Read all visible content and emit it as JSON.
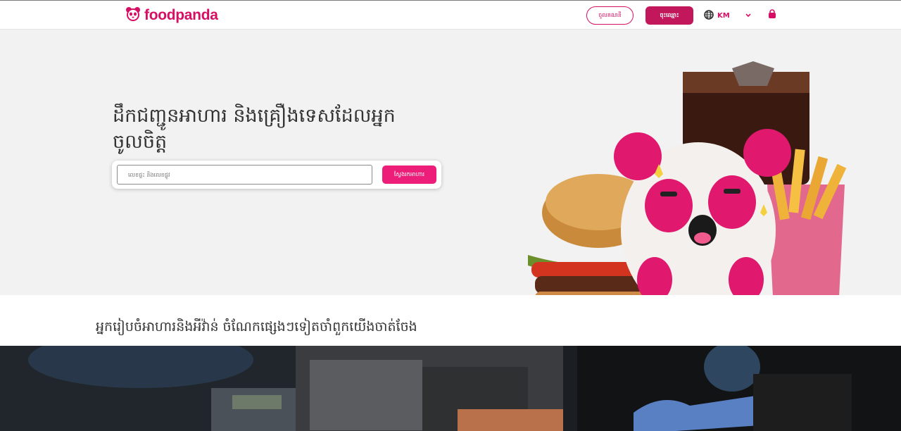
{
  "header": {
    "brand": "foodpanda",
    "login_label": "ចូលគណនី",
    "signup_label": "ចុះឈ្មោះ",
    "language": "KM",
    "icons": [
      "panda-logo-icon",
      "globe-icon",
      "chevron-down-icon",
      "shopping-bag-icon"
    ]
  },
  "hero": {
    "title": "ដឹកជញ្ជូនអាហារ និងគ្រឿងទេសដែលអ្នកចូលចិត្ត",
    "search": {
      "placeholder": "លេខផ្ទះ និងលេខផ្លូវ",
      "button_label": "ស្វែងរកអាហារ"
    }
  },
  "section": {
    "title": "អ្នករៀបចំអាហារនិងអីវ៉ាន់ ចំណែកផ្សេងៗទៀតចាំពួកយើងចាត់ចែង"
  },
  "colors": {
    "brand": "#d70f64",
    "accent": "#ec1e79",
    "hero_bg": "#f2f2f2"
  }
}
